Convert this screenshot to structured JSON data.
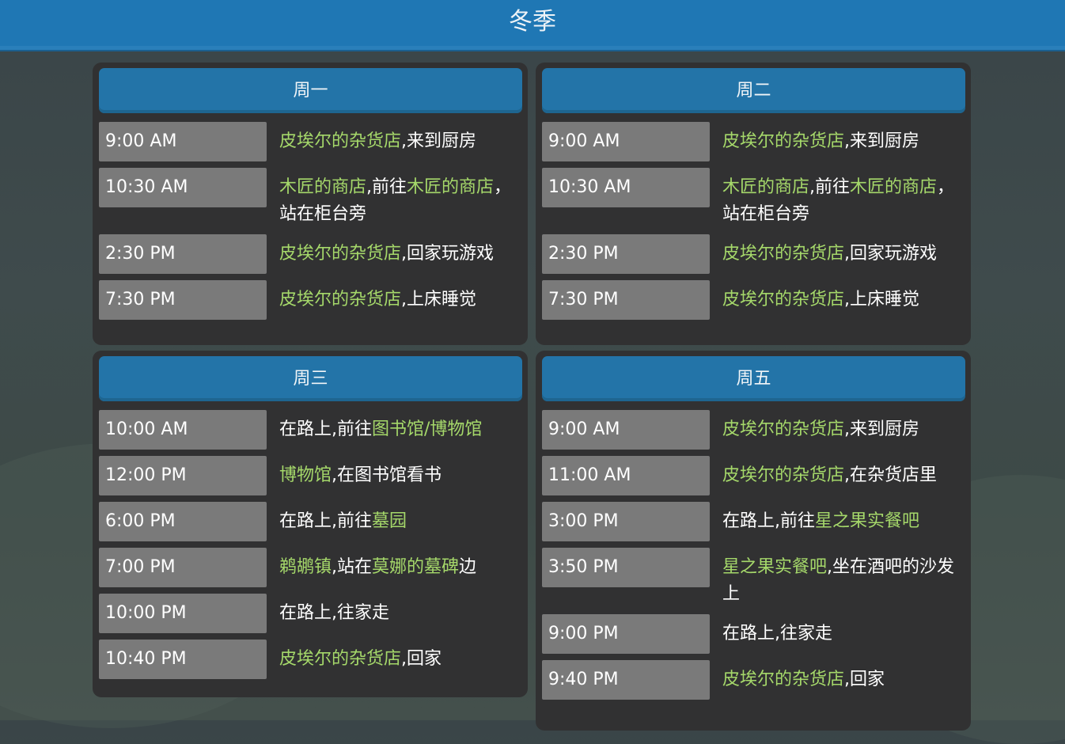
{
  "header": {
    "title": "冬季"
  },
  "days": [
    {
      "name": "周一",
      "entries": [
        {
          "time": "9:00 AM",
          "parts": [
            {
              "text": "皮埃尔的杂货店",
              "hl": true
            },
            {
              "text": ",来到厨房",
              "hl": false
            }
          ]
        },
        {
          "time": "10:30 AM",
          "parts": [
            {
              "text": "木匠的商店",
              "hl": true
            },
            {
              "text": ",前往",
              "hl": false
            },
            {
              "text": "木匠的商店",
              "hl": true
            },
            {
              "text": "，站在柜台旁",
              "hl": false
            }
          ]
        },
        {
          "time": "2:30 PM",
          "parts": [
            {
              "text": "皮埃尔的杂货店",
              "hl": true
            },
            {
              "text": ",回家玩游戏",
              "hl": false
            }
          ]
        },
        {
          "time": "7:30 PM",
          "parts": [
            {
              "text": "皮埃尔的杂货店",
              "hl": true
            },
            {
              "text": ",上床睡觉",
              "hl": false
            }
          ]
        }
      ]
    },
    {
      "name": "周二",
      "entries": [
        {
          "time": "9:00 AM",
          "parts": [
            {
              "text": "皮埃尔的杂货店",
              "hl": true
            },
            {
              "text": ",来到厨房",
              "hl": false
            }
          ]
        },
        {
          "time": "10:30 AM",
          "parts": [
            {
              "text": "木匠的商店",
              "hl": true
            },
            {
              "text": ",前往",
              "hl": false
            },
            {
              "text": "木匠的商店",
              "hl": true
            },
            {
              "text": "，站在柜台旁",
              "hl": false
            }
          ]
        },
        {
          "time": "2:30 PM",
          "parts": [
            {
              "text": "皮埃尔的杂货店",
              "hl": true
            },
            {
              "text": ",回家玩游戏",
              "hl": false
            }
          ]
        },
        {
          "time": "7:30 PM",
          "parts": [
            {
              "text": "皮埃尔的杂货店",
              "hl": true
            },
            {
              "text": ",上床睡觉",
              "hl": false
            }
          ]
        }
      ]
    },
    {
      "name": "周三",
      "entries": [
        {
          "time": "10:00 AM",
          "parts": [
            {
              "text": "在路上,前往",
              "hl": false
            },
            {
              "text": "图书馆/博物馆",
              "hl": true
            }
          ]
        },
        {
          "time": "12:00 PM",
          "parts": [
            {
              "text": "博物馆",
              "hl": true
            },
            {
              "text": ",在图书馆看书",
              "hl": false
            }
          ]
        },
        {
          "time": "6:00 PM",
          "parts": [
            {
              "text": "在路上,前往",
              "hl": false
            },
            {
              "text": "墓园",
              "hl": true
            }
          ]
        },
        {
          "time": "7:00 PM",
          "parts": [
            {
              "text": "鹈鹕镇",
              "hl": true
            },
            {
              "text": ",站在",
              "hl": false
            },
            {
              "text": "莫娜的墓碑",
              "hl": true
            },
            {
              "text": "边",
              "hl": false
            }
          ]
        },
        {
          "time": "10:00 PM",
          "parts": [
            {
              "text": "在路上,往家走",
              "hl": false
            }
          ]
        },
        {
          "time": "10:40 PM",
          "parts": [
            {
              "text": "皮埃尔的杂货店",
              "hl": true
            },
            {
              "text": ",回家",
              "hl": false
            }
          ]
        }
      ]
    },
    {
      "name": "周五",
      "entries": [
        {
          "time": "9:00 AM",
          "parts": [
            {
              "text": "皮埃尔的杂货店",
              "hl": true
            },
            {
              "text": ",来到厨房",
              "hl": false
            }
          ]
        },
        {
          "time": "11:00 AM",
          "parts": [
            {
              "text": "皮埃尔的杂货店",
              "hl": true
            },
            {
              "text": ",在杂货店里",
              "hl": false
            }
          ]
        },
        {
          "time": "3:00 PM",
          "parts": [
            {
              "text": "在路上,前往",
              "hl": false
            },
            {
              "text": "星之果实餐吧",
              "hl": true
            }
          ]
        },
        {
          "time": "3:50 PM",
          "parts": [
            {
              "text": "星之果实餐吧",
              "hl": true
            },
            {
              "text": ",坐在酒吧的沙发上",
              "hl": false
            }
          ]
        },
        {
          "time": "9:00 PM",
          "parts": [
            {
              "text": "在路上,往家走",
              "hl": false
            }
          ]
        },
        {
          "time": "9:40 PM",
          "parts": [
            {
              "text": "皮埃尔的杂货店",
              "hl": true
            },
            {
              "text": ",回家",
              "hl": false
            }
          ]
        }
      ]
    }
  ]
}
